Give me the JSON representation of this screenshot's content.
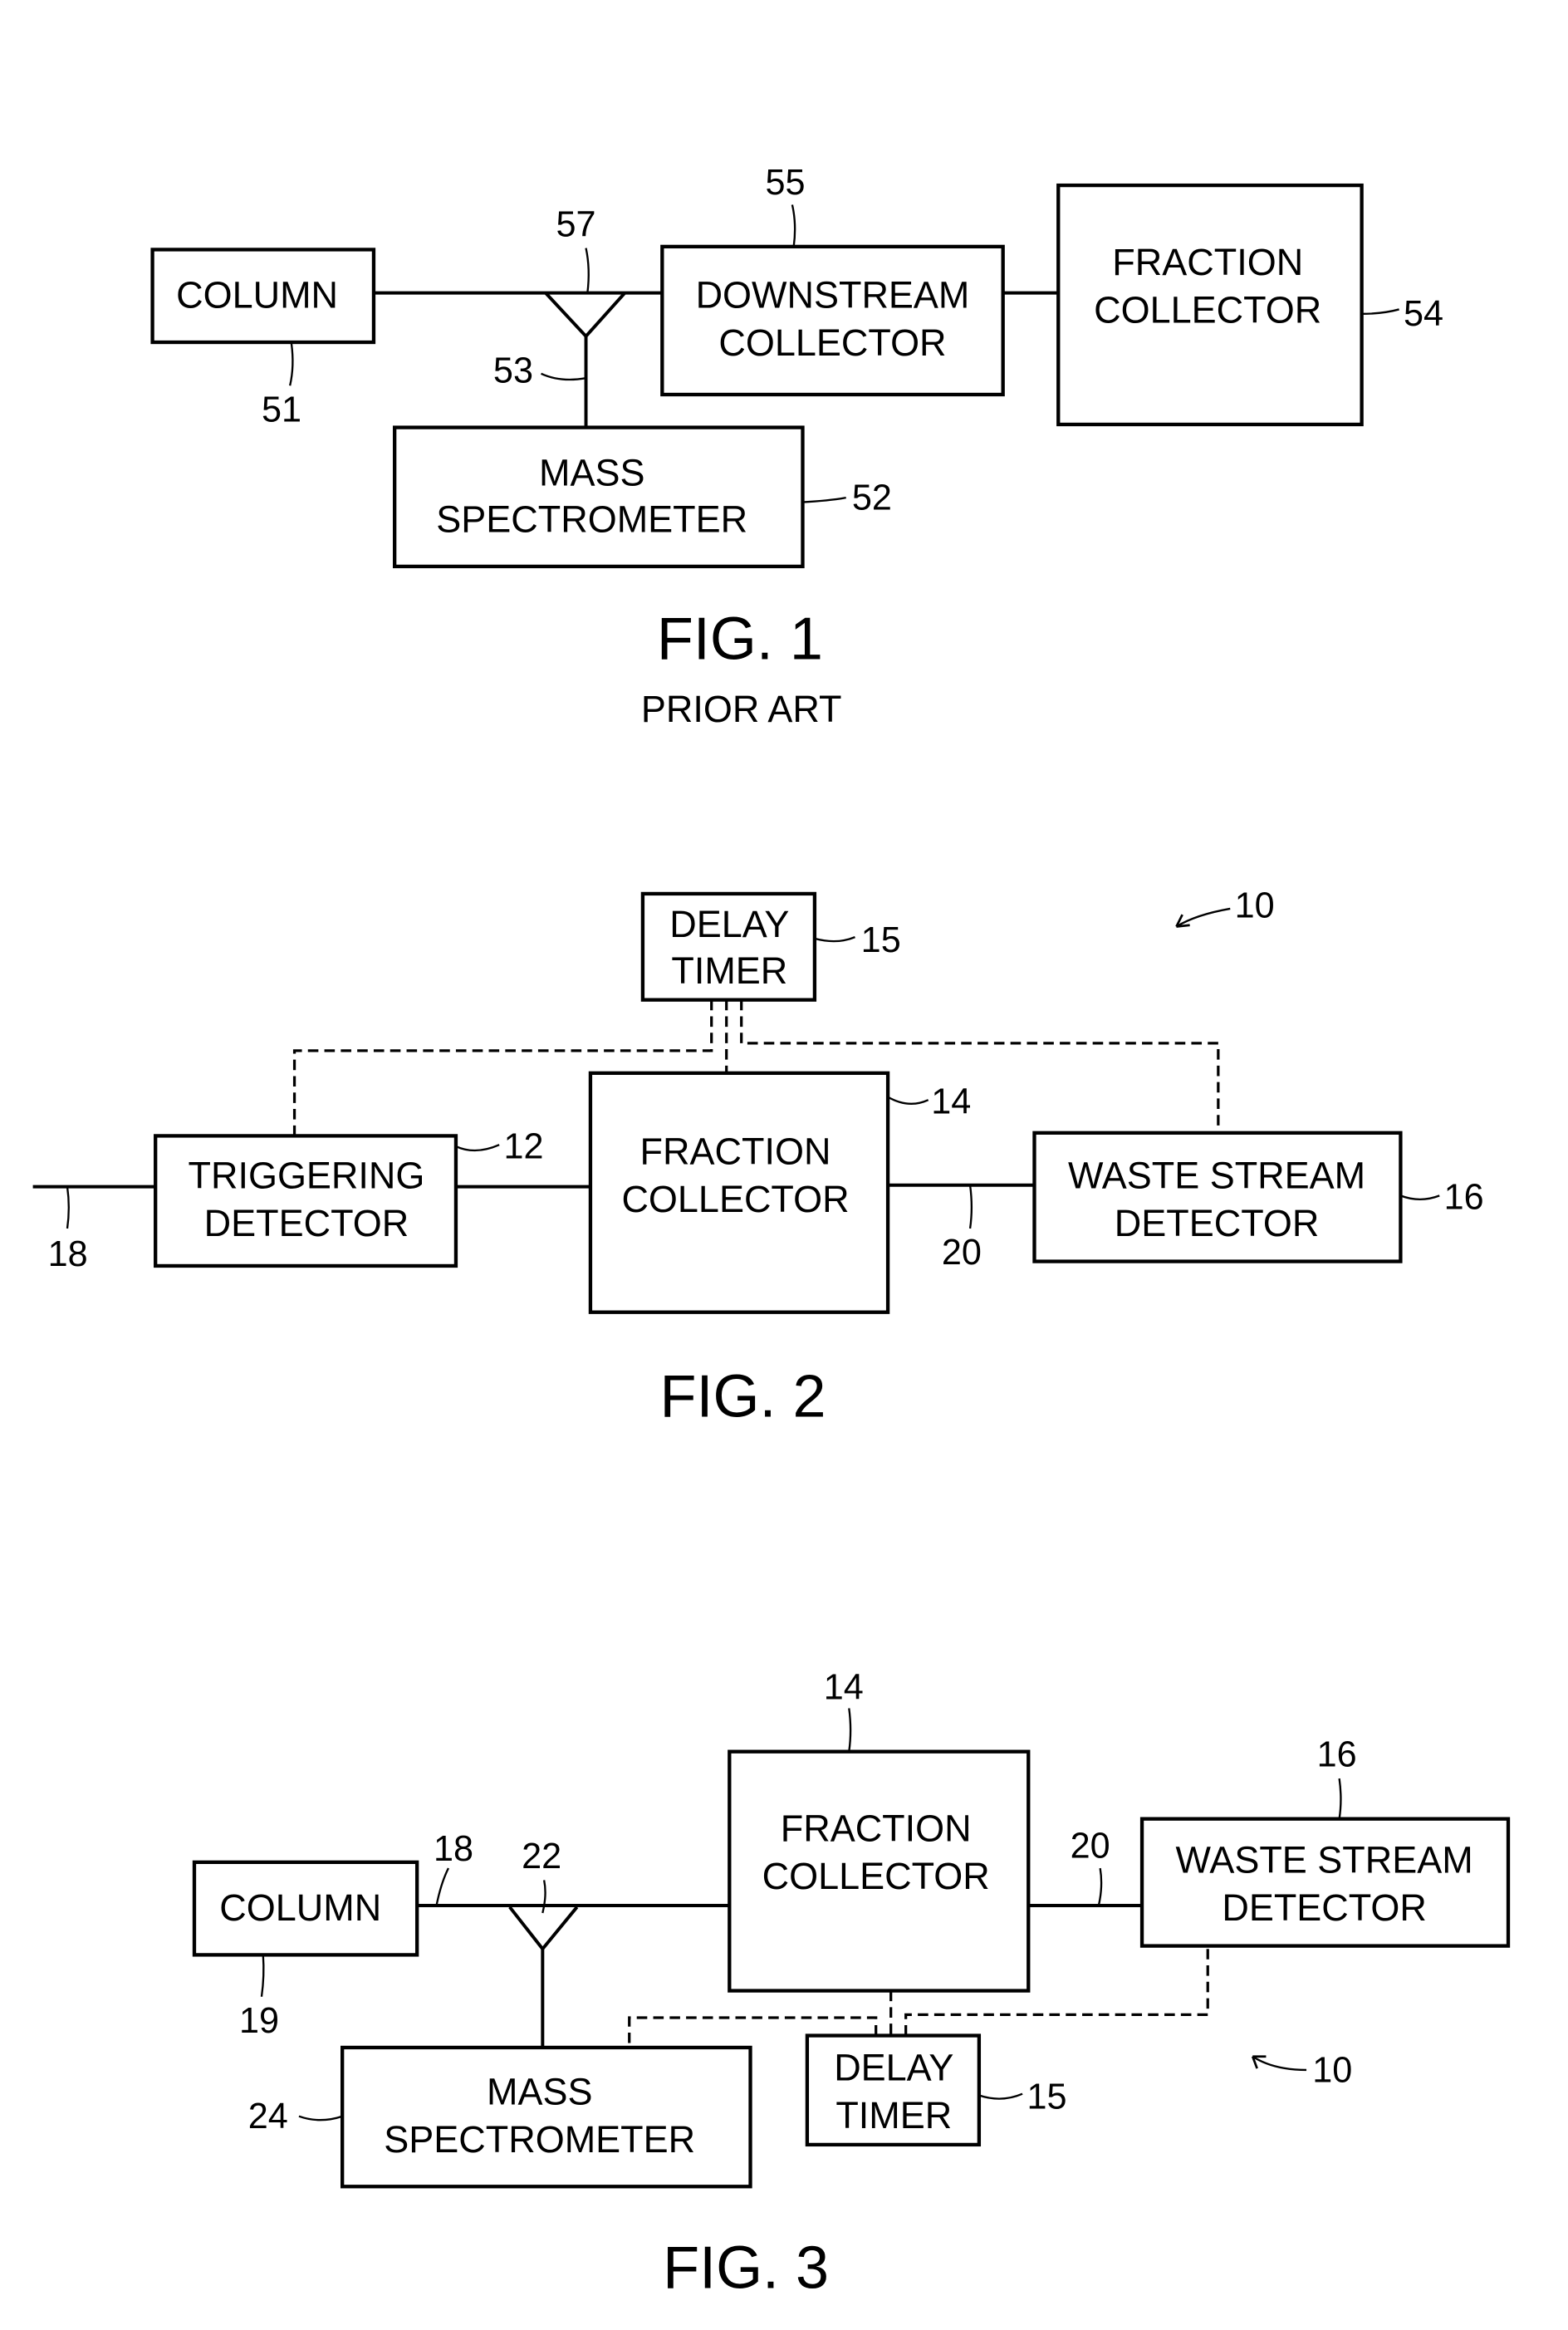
{
  "fig1": {
    "caption": "FIG. 1",
    "subcaption": "PRIOR ART",
    "column": {
      "label": "COLUMN",
      "ref": "51"
    },
    "splitter": {
      "ref": "57"
    },
    "ms_line": {
      "ref": "53"
    },
    "mass_spec": {
      "line1": "MASS",
      "line2": "SPECTROMETER",
      "ref": "52"
    },
    "downstream": {
      "line1": "DOWNSTREAM",
      "line2": "COLLECTOR",
      "ref": "55"
    },
    "fraction": {
      "line1": "FRACTION",
      "line2": "COLLECTOR",
      "ref": "54"
    }
  },
  "fig2": {
    "caption": "FIG. 2",
    "system_ref": "10",
    "delay": {
      "line1": "DELAY",
      "line2": "TIMER",
      "ref": "15"
    },
    "trigger": {
      "line1": "TRIGGERING",
      "line2": "DETECTOR",
      "ref": "12"
    },
    "fraction": {
      "line1": "FRACTION",
      "line2": "COLLECTOR",
      "ref": "14"
    },
    "waste": {
      "line1": "WASTE STREAM",
      "line2": "DETECTOR",
      "ref": "16"
    },
    "inlet_ref": "18",
    "outlet_ref": "20"
  },
  "fig3": {
    "caption": "FIG. 3",
    "system_ref": "10",
    "column": {
      "label": "COLUMN",
      "ref": "19"
    },
    "line_ref": "18",
    "splitter_ref": "22",
    "fraction": {
      "line1": "FRACTION",
      "line2": "COLLECTOR",
      "ref": "14"
    },
    "outlet_ref": "20",
    "waste": {
      "line1": "WASTE STREAM",
      "line2": "DETECTOR",
      "ref": "16"
    },
    "mass_spec": {
      "line1": "MASS",
      "line2": "SPECTROMETER",
      "ref": "24"
    },
    "delay": {
      "line1": "DELAY",
      "line2": "TIMER",
      "ref": "15"
    }
  }
}
